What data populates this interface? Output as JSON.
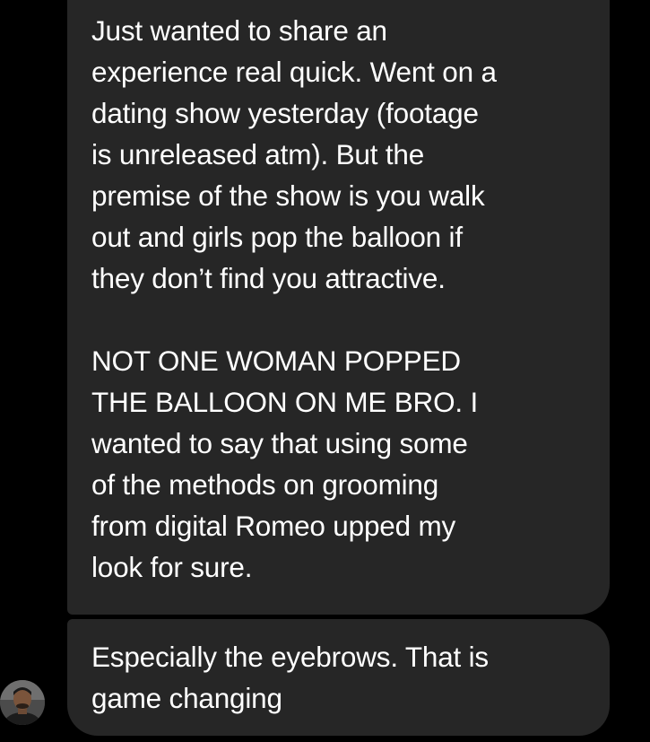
{
  "conversation": {
    "messages": [
      {
        "paragraphs": [
          "Just wanted to share an\nexperience real quick. Went on a\ndating show yesterday (footage\nis unreleased atm). But the\npremise of the show is you walk\nout and girls pop the balloon if\nthey don’t find you attractive.",
          "NOT ONE WOMAN POPPED\nTHE BALLOON ON ME BRO. I\nwanted to say that using some\nof the methods on grooming\nfrom digital Romeo upped my\nlook for sure."
        ]
      },
      {
        "paragraphs": [
          "Especially the eyebrows. That is\ngame changing"
        ]
      }
    ],
    "sender_avatar": {
      "icon": "profile-photo"
    }
  },
  "colors": {
    "background": "#000000",
    "bubble": "#262626",
    "text": "#ffffff"
  }
}
